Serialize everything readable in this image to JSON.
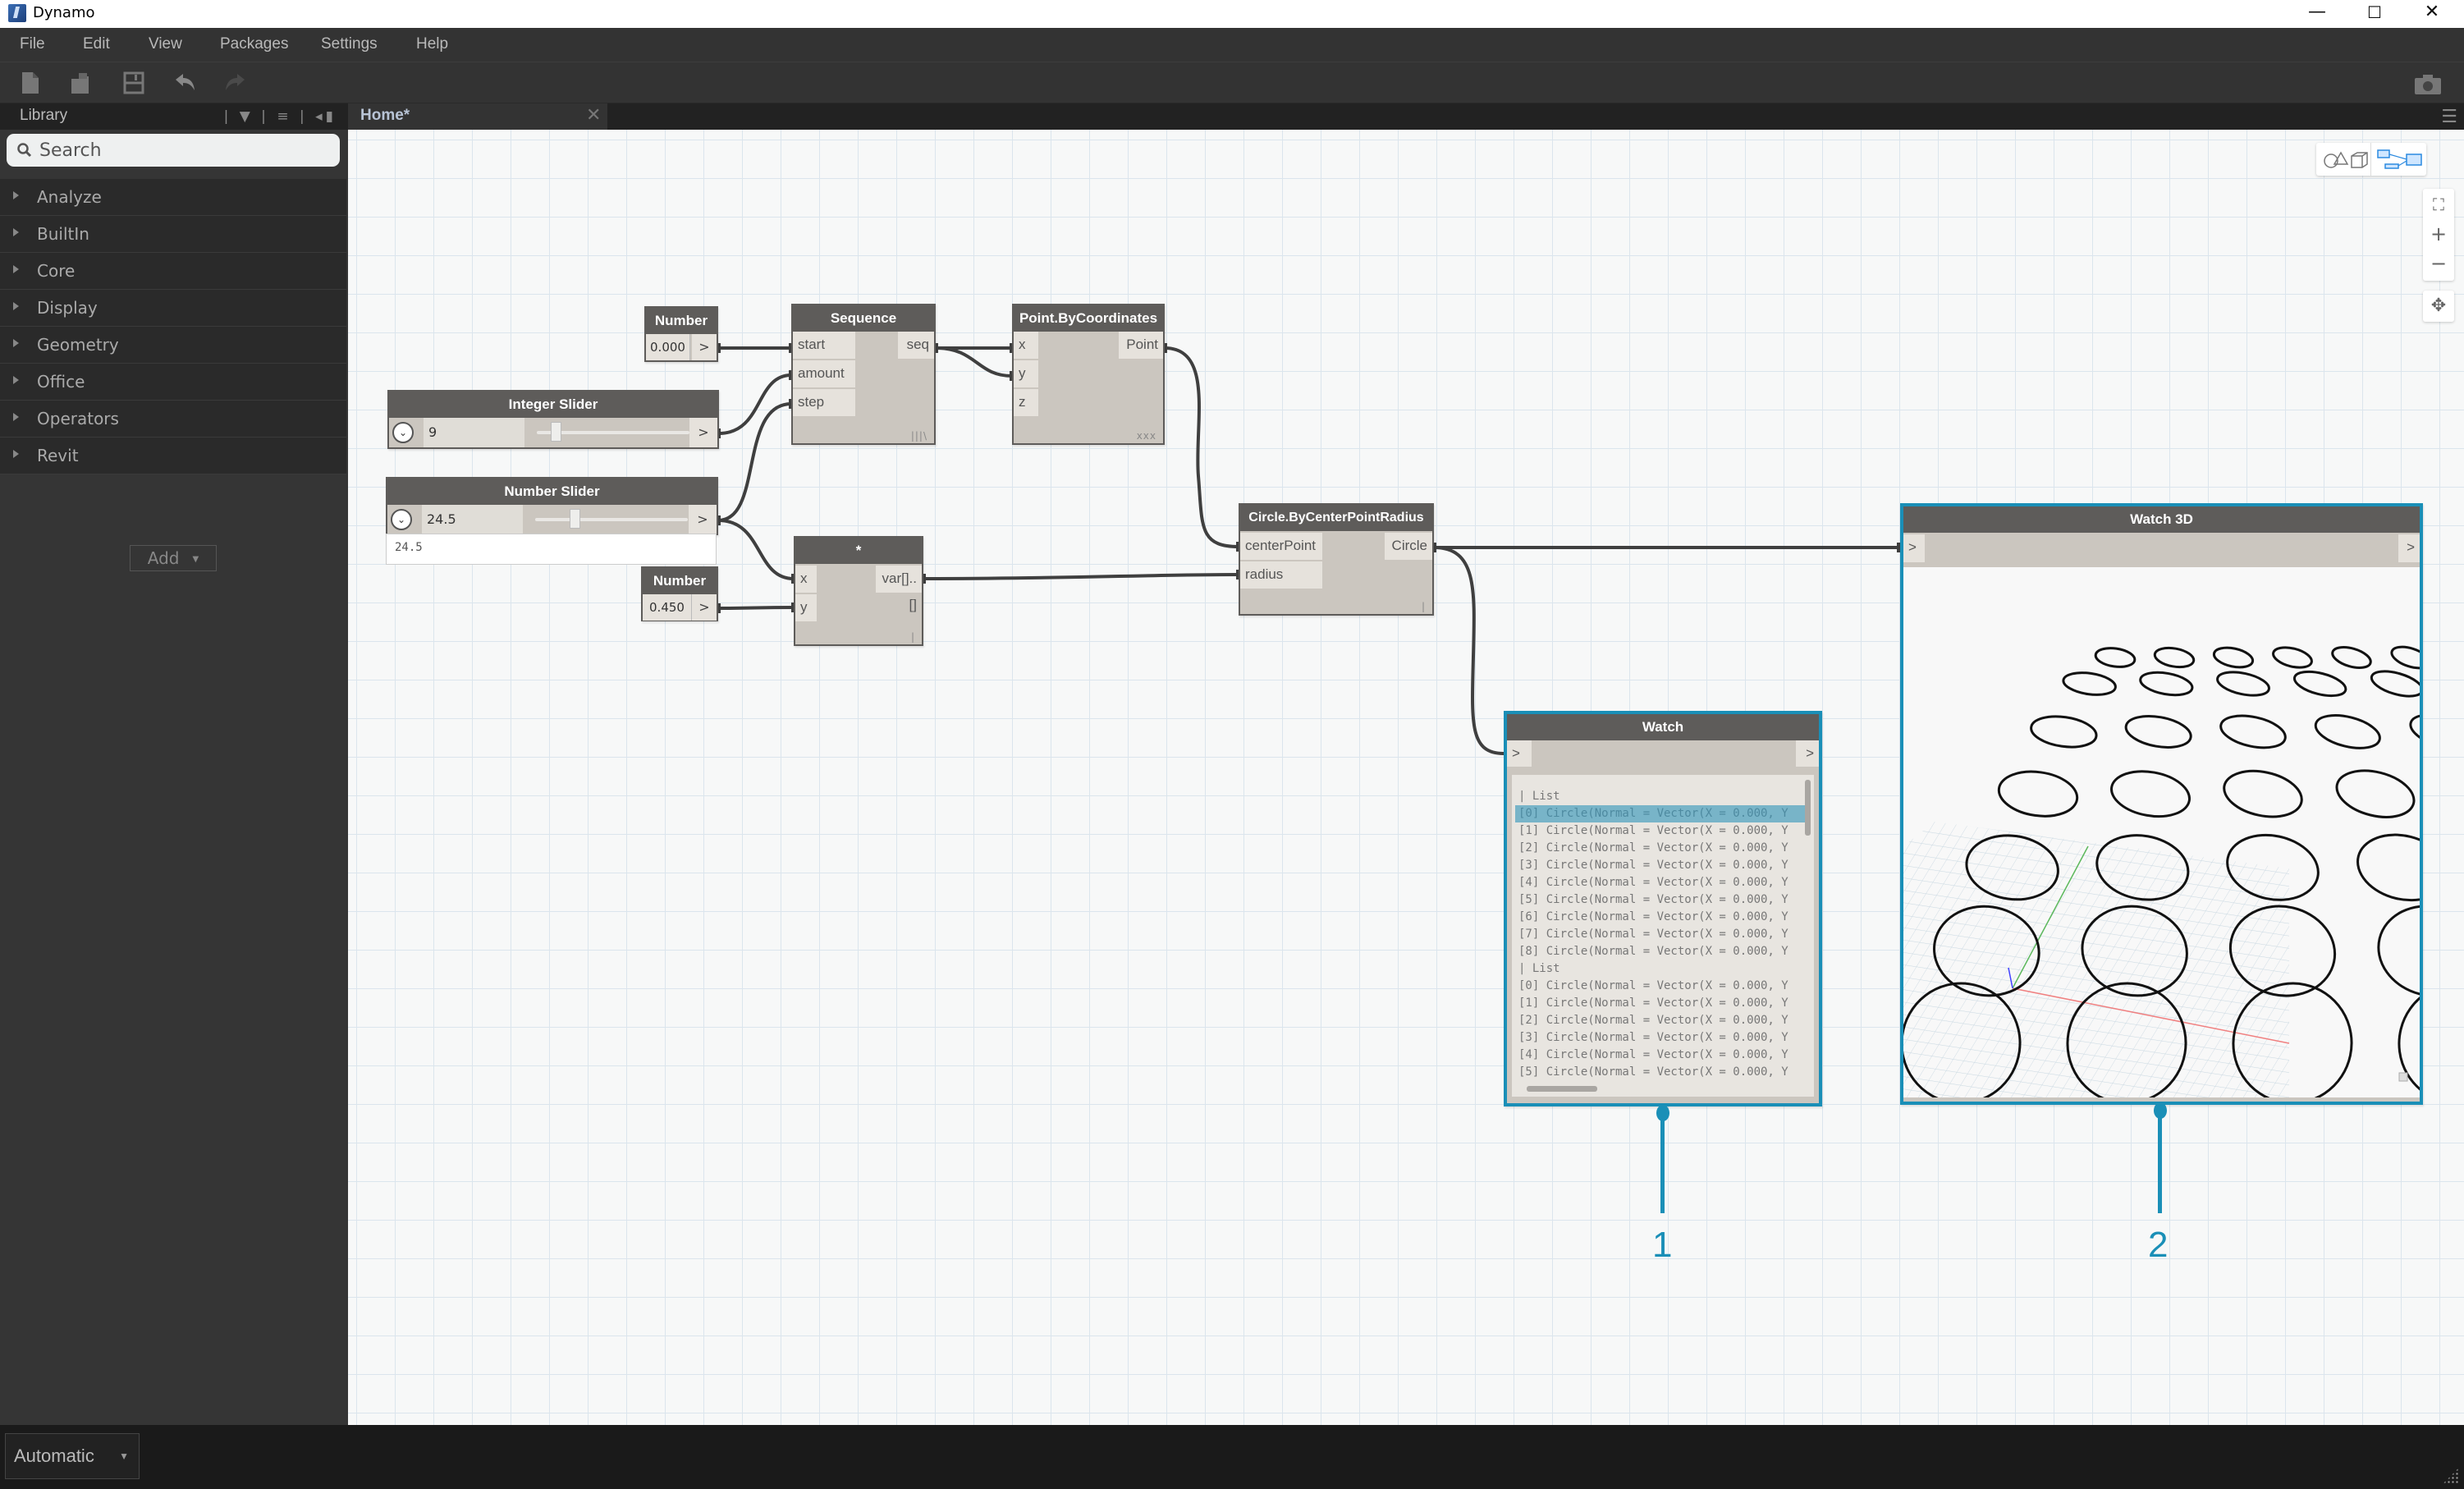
{
  "window": {
    "title": "Dynamo",
    "controls": {
      "minimize": "—",
      "maximize": "☐",
      "close": "✕"
    }
  },
  "menu": [
    "File",
    "Edit",
    "View",
    "Packages",
    "Settings",
    "Help"
  ],
  "toolbar": {
    "icons": [
      "new-file-icon",
      "open-file-icon",
      "save-icon",
      "undo-icon",
      "redo-icon"
    ],
    "camera_icon": "camera-icon"
  },
  "library": {
    "title": "Library",
    "tools": "| ▼ | ≡ | ◂▮",
    "search": {
      "placeholder": "Search",
      "value": ""
    },
    "categories": [
      "Analyze",
      "BuiltIn",
      "Core",
      "Display",
      "Geometry",
      "Office",
      "Operators",
      "Revit"
    ],
    "add_label": "Add",
    "add_caret": "▼"
  },
  "tabs": [
    {
      "label": "Home*",
      "close": "✕"
    }
  ],
  "tab_menu_icon": "☰",
  "canvas_controls": {
    "fit": "⛶",
    "zoom_in": "+",
    "zoom_out": "−",
    "pan": "✥"
  },
  "nodes": {
    "number1": {
      "title": "Number",
      "value": "0.000",
      "out": ">"
    },
    "int_slider": {
      "title": "Integer Slider",
      "value": "9",
      "out": ">",
      "expand": "⌄",
      "position": 0.1
    },
    "num_slider": {
      "title": "Number Slider",
      "value": "24.5",
      "out": ">",
      "expand": "⌄",
      "position": 0.245,
      "text_value": "24.5"
    },
    "number2": {
      "title": "Number",
      "value": "0.450",
      "out": ">"
    },
    "sequence": {
      "title": "Sequence",
      "inputs": [
        "start",
        "amount",
        "step"
      ],
      "output": "seq",
      "lacing": "|||\\"
    },
    "multiply": {
      "title": "*",
      "inputs": [
        "x",
        "y"
      ],
      "output": "var[]..[]",
      "lacing": "|"
    },
    "point": {
      "title": "Point.ByCoordinates",
      "inputs": [
        "x",
        "y",
        "z"
      ],
      "output": "Point",
      "lacing": "xxx"
    },
    "circle": {
      "title": "Circle.ByCenterPointRadius",
      "inputs": [
        "centerPoint",
        "radius"
      ],
      "output": "Circle",
      "lacing": "|"
    },
    "watch": {
      "title": "Watch",
      "in": ">",
      "out": ">",
      "lines": [
        {
          "text": "| List",
          "type": "hd"
        },
        {
          "text": "[0] Circle(Normal = Vector(X = 0.000, Y",
          "type": "hl"
        },
        {
          "text": "[1] Circle(Normal = Vector(X = 0.000, Y",
          "type": ""
        },
        {
          "text": "[2] Circle(Normal = Vector(X = 0.000, Y",
          "type": ""
        },
        {
          "text": "[3] Circle(Normal = Vector(X = 0.000, Y",
          "type": ""
        },
        {
          "text": "[4] Circle(Normal = Vector(X = 0.000, Y",
          "type": ""
        },
        {
          "text": "[5] Circle(Normal = Vector(X = 0.000, Y",
          "type": ""
        },
        {
          "text": "[6] Circle(Normal = Vector(X = 0.000, Y",
          "type": ""
        },
        {
          "text": "[7] Circle(Normal = Vector(X = 0.000, Y",
          "type": ""
        },
        {
          "text": "[8] Circle(Normal = Vector(X = 0.000, Y",
          "type": ""
        },
        {
          "text": "| List",
          "type": "hd"
        },
        {
          "text": "[0] Circle(Normal = Vector(X = 0.000, Y",
          "type": ""
        },
        {
          "text": "[1] Circle(Normal = Vector(X = 0.000, Y",
          "type": ""
        },
        {
          "text": "[2] Circle(Normal = Vector(X = 0.000, Y",
          "type": ""
        },
        {
          "text": "[3] Circle(Normal = Vector(X = 0.000, Y",
          "type": ""
        },
        {
          "text": "[4] Circle(Normal = Vector(X = 0.000, Y",
          "type": ""
        },
        {
          "text": "[5] Circle(Normal = Vector(X = 0.000, Y",
          "type": ""
        }
      ]
    },
    "watch3d": {
      "title": "Watch 3D",
      "in": ">",
      "out": ">"
    }
  },
  "callouts": [
    "1",
    "2"
  ],
  "status": {
    "run_mode": "Automatic",
    "caret": "▼"
  },
  "colors": {
    "accent": "#1a8fb7",
    "node_header": "#5e5c5a",
    "node_body": "#cbc6bf",
    "port": "#e6e2dc"
  }
}
